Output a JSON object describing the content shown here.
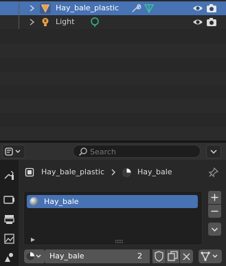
{
  "outliner": {
    "rows": [
      {
        "label": "Hay_bale_plastic",
        "selected": true
      },
      {
        "label": "Light",
        "selected": false
      }
    ]
  },
  "header": {
    "search": {
      "placeholder": "Search"
    }
  },
  "breadcrumb": {
    "object": "Hay_bale_plastic",
    "material": "Hay_bale"
  },
  "material_slots": {
    "items": [
      {
        "label": "Hay_bale"
      }
    ]
  },
  "datablock": {
    "name": "Hay_bale",
    "users": "2"
  },
  "colors": {
    "selection": "#4772b3",
    "object_orange": "#e8a04c",
    "data_teal": "#3fc1a0",
    "light_green": "#31b78a"
  }
}
